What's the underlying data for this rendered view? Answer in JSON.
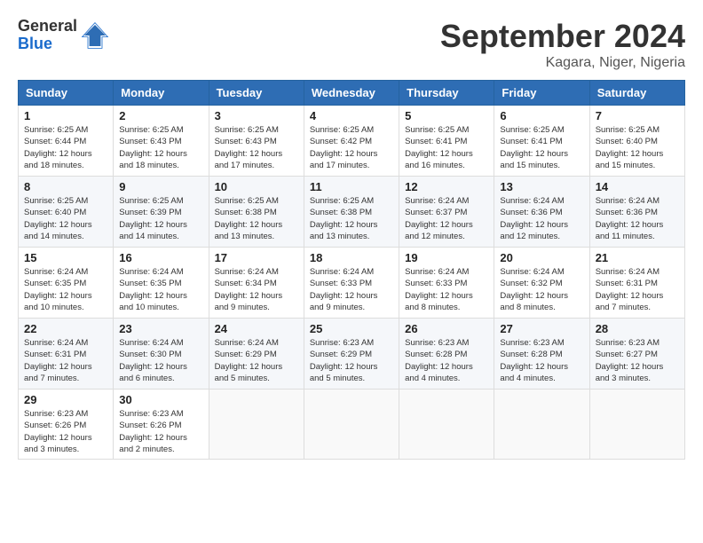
{
  "logo": {
    "general": "General",
    "blue": "Blue"
  },
  "title": "September 2024",
  "location": "Kagara, Niger, Nigeria",
  "headers": [
    "Sunday",
    "Monday",
    "Tuesday",
    "Wednesday",
    "Thursday",
    "Friday",
    "Saturday"
  ],
  "weeks": [
    [
      {
        "day": "1",
        "sunrise": "6:25 AM",
        "sunset": "6:44 PM",
        "daylight": "12 hours and 18 minutes."
      },
      {
        "day": "2",
        "sunrise": "6:25 AM",
        "sunset": "6:43 PM",
        "daylight": "12 hours and 18 minutes."
      },
      {
        "day": "3",
        "sunrise": "6:25 AM",
        "sunset": "6:43 PM",
        "daylight": "12 hours and 17 minutes."
      },
      {
        "day": "4",
        "sunrise": "6:25 AM",
        "sunset": "6:42 PM",
        "daylight": "12 hours and 17 minutes."
      },
      {
        "day": "5",
        "sunrise": "6:25 AM",
        "sunset": "6:41 PM",
        "daylight": "12 hours and 16 minutes."
      },
      {
        "day": "6",
        "sunrise": "6:25 AM",
        "sunset": "6:41 PM",
        "daylight": "12 hours and 15 minutes."
      },
      {
        "day": "7",
        "sunrise": "6:25 AM",
        "sunset": "6:40 PM",
        "daylight": "12 hours and 15 minutes."
      }
    ],
    [
      {
        "day": "8",
        "sunrise": "6:25 AM",
        "sunset": "6:40 PM",
        "daylight": "12 hours and 14 minutes."
      },
      {
        "day": "9",
        "sunrise": "6:25 AM",
        "sunset": "6:39 PM",
        "daylight": "12 hours and 14 minutes."
      },
      {
        "day": "10",
        "sunrise": "6:25 AM",
        "sunset": "6:38 PM",
        "daylight": "12 hours and 13 minutes."
      },
      {
        "day": "11",
        "sunrise": "6:25 AM",
        "sunset": "6:38 PM",
        "daylight": "12 hours and 13 minutes."
      },
      {
        "day": "12",
        "sunrise": "6:24 AM",
        "sunset": "6:37 PM",
        "daylight": "12 hours and 12 minutes."
      },
      {
        "day": "13",
        "sunrise": "6:24 AM",
        "sunset": "6:36 PM",
        "daylight": "12 hours and 12 minutes."
      },
      {
        "day": "14",
        "sunrise": "6:24 AM",
        "sunset": "6:36 PM",
        "daylight": "12 hours and 11 minutes."
      }
    ],
    [
      {
        "day": "15",
        "sunrise": "6:24 AM",
        "sunset": "6:35 PM",
        "daylight": "12 hours and 10 minutes."
      },
      {
        "day": "16",
        "sunrise": "6:24 AM",
        "sunset": "6:35 PM",
        "daylight": "12 hours and 10 minutes."
      },
      {
        "day": "17",
        "sunrise": "6:24 AM",
        "sunset": "6:34 PM",
        "daylight": "12 hours and 9 minutes."
      },
      {
        "day": "18",
        "sunrise": "6:24 AM",
        "sunset": "6:33 PM",
        "daylight": "12 hours and 9 minutes."
      },
      {
        "day": "19",
        "sunrise": "6:24 AM",
        "sunset": "6:33 PM",
        "daylight": "12 hours and 8 minutes."
      },
      {
        "day": "20",
        "sunrise": "6:24 AM",
        "sunset": "6:32 PM",
        "daylight": "12 hours and 8 minutes."
      },
      {
        "day": "21",
        "sunrise": "6:24 AM",
        "sunset": "6:31 PM",
        "daylight": "12 hours and 7 minutes."
      }
    ],
    [
      {
        "day": "22",
        "sunrise": "6:24 AM",
        "sunset": "6:31 PM",
        "daylight": "12 hours and 7 minutes."
      },
      {
        "day": "23",
        "sunrise": "6:24 AM",
        "sunset": "6:30 PM",
        "daylight": "12 hours and 6 minutes."
      },
      {
        "day": "24",
        "sunrise": "6:24 AM",
        "sunset": "6:29 PM",
        "daylight": "12 hours and 5 minutes."
      },
      {
        "day": "25",
        "sunrise": "6:23 AM",
        "sunset": "6:29 PM",
        "daylight": "12 hours and 5 minutes."
      },
      {
        "day": "26",
        "sunrise": "6:23 AM",
        "sunset": "6:28 PM",
        "daylight": "12 hours and 4 minutes."
      },
      {
        "day": "27",
        "sunrise": "6:23 AM",
        "sunset": "6:28 PM",
        "daylight": "12 hours and 4 minutes."
      },
      {
        "day": "28",
        "sunrise": "6:23 AM",
        "sunset": "6:27 PM",
        "daylight": "12 hours and 3 minutes."
      }
    ],
    [
      {
        "day": "29",
        "sunrise": "6:23 AM",
        "sunset": "6:26 PM",
        "daylight": "12 hours and 3 minutes."
      },
      {
        "day": "30",
        "sunrise": "6:23 AM",
        "sunset": "6:26 PM",
        "daylight": "12 hours and 2 minutes."
      },
      null,
      null,
      null,
      null,
      null
    ]
  ],
  "labels": {
    "sunrise": "Sunrise:",
    "sunset": "Sunset:",
    "daylight": "Daylight:"
  }
}
